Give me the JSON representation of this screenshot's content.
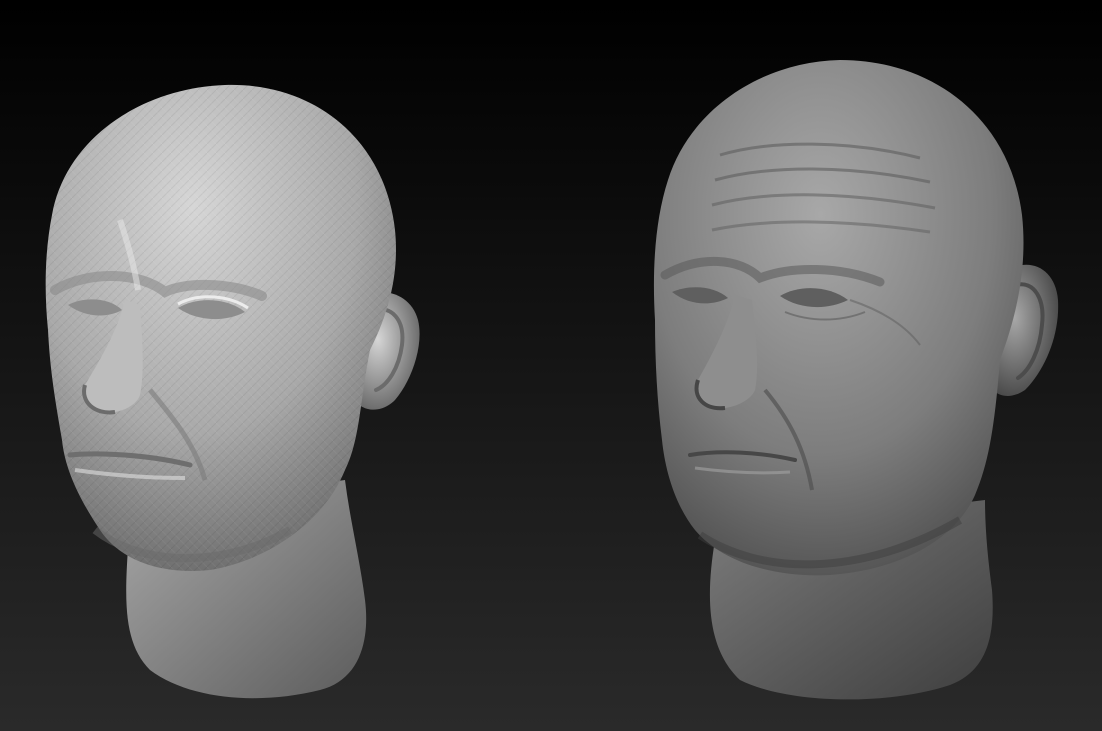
{
  "scene": {
    "background_top": "#000000",
    "background_bottom": "#2a2a2a",
    "model_left": {
      "stage": "low-resolution",
      "surface_light": "#d6d6d6",
      "surface_mid": "#a9a9a9",
      "surface_dark": "#5c5c5c"
    },
    "model_right": {
      "stage": "high-resolution",
      "surface_light": "#a8a8a8",
      "surface_mid": "#7d7d7d",
      "surface_dark": "#3e3e3e"
    }
  }
}
